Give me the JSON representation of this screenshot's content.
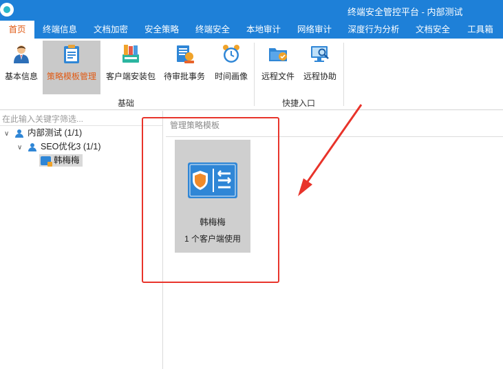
{
  "window": {
    "title": "终端安全管控平台 - 内部测试"
  },
  "menu": {
    "items": [
      {
        "label": "首页",
        "active": true
      },
      {
        "label": "终端信息"
      },
      {
        "label": "文档加密"
      },
      {
        "label": "安全策略"
      },
      {
        "label": "终端安全"
      },
      {
        "label": "本地审计"
      },
      {
        "label": "网络审计"
      },
      {
        "label": "深度行为分析"
      },
      {
        "label": "文档安全"
      },
      {
        "label": "工具箱"
      }
    ]
  },
  "ribbon": {
    "buttons": [
      {
        "label": "基本信息",
        "icon": "user-icon"
      },
      {
        "label": "策略模板管理",
        "icon": "clipboard-icon",
        "selected": true
      },
      {
        "label": "客户端安装包",
        "icon": "installer-package-icon"
      },
      {
        "label": "待审批事务",
        "icon": "approval-document-icon"
      },
      {
        "label": "时间画像",
        "icon": "alarm-clock-icon"
      },
      {
        "label": "远程文件",
        "icon": "remote-folder-icon"
      },
      {
        "label": "远程协助",
        "icon": "remote-assist-monitor-icon"
      }
    ],
    "groups": [
      {
        "label": "基础"
      },
      {
        "label": "快捷入口"
      }
    ]
  },
  "tree": {
    "filter_placeholder": "在此输入关键字筛选...",
    "nodes": [
      {
        "label": "内部测试 (1/1)",
        "icon": "user-group-icon",
        "expanded": true
      },
      {
        "label": "SEO优化3 (1/1)",
        "icon": "user-group-icon",
        "expanded": true
      },
      {
        "label": "韩梅梅",
        "icon": "client-computer-icon",
        "selected": true
      }
    ]
  },
  "content": {
    "header": "管理策略模板",
    "templates": [
      {
        "name": "韩梅梅",
        "usage": "1 个客户端使用",
        "icon": "policy-shield-settings-icon"
      }
    ]
  },
  "colors": {
    "titlebar": "#1e80d8",
    "accent": "#e05a14",
    "annotation": "#e8332a"
  }
}
